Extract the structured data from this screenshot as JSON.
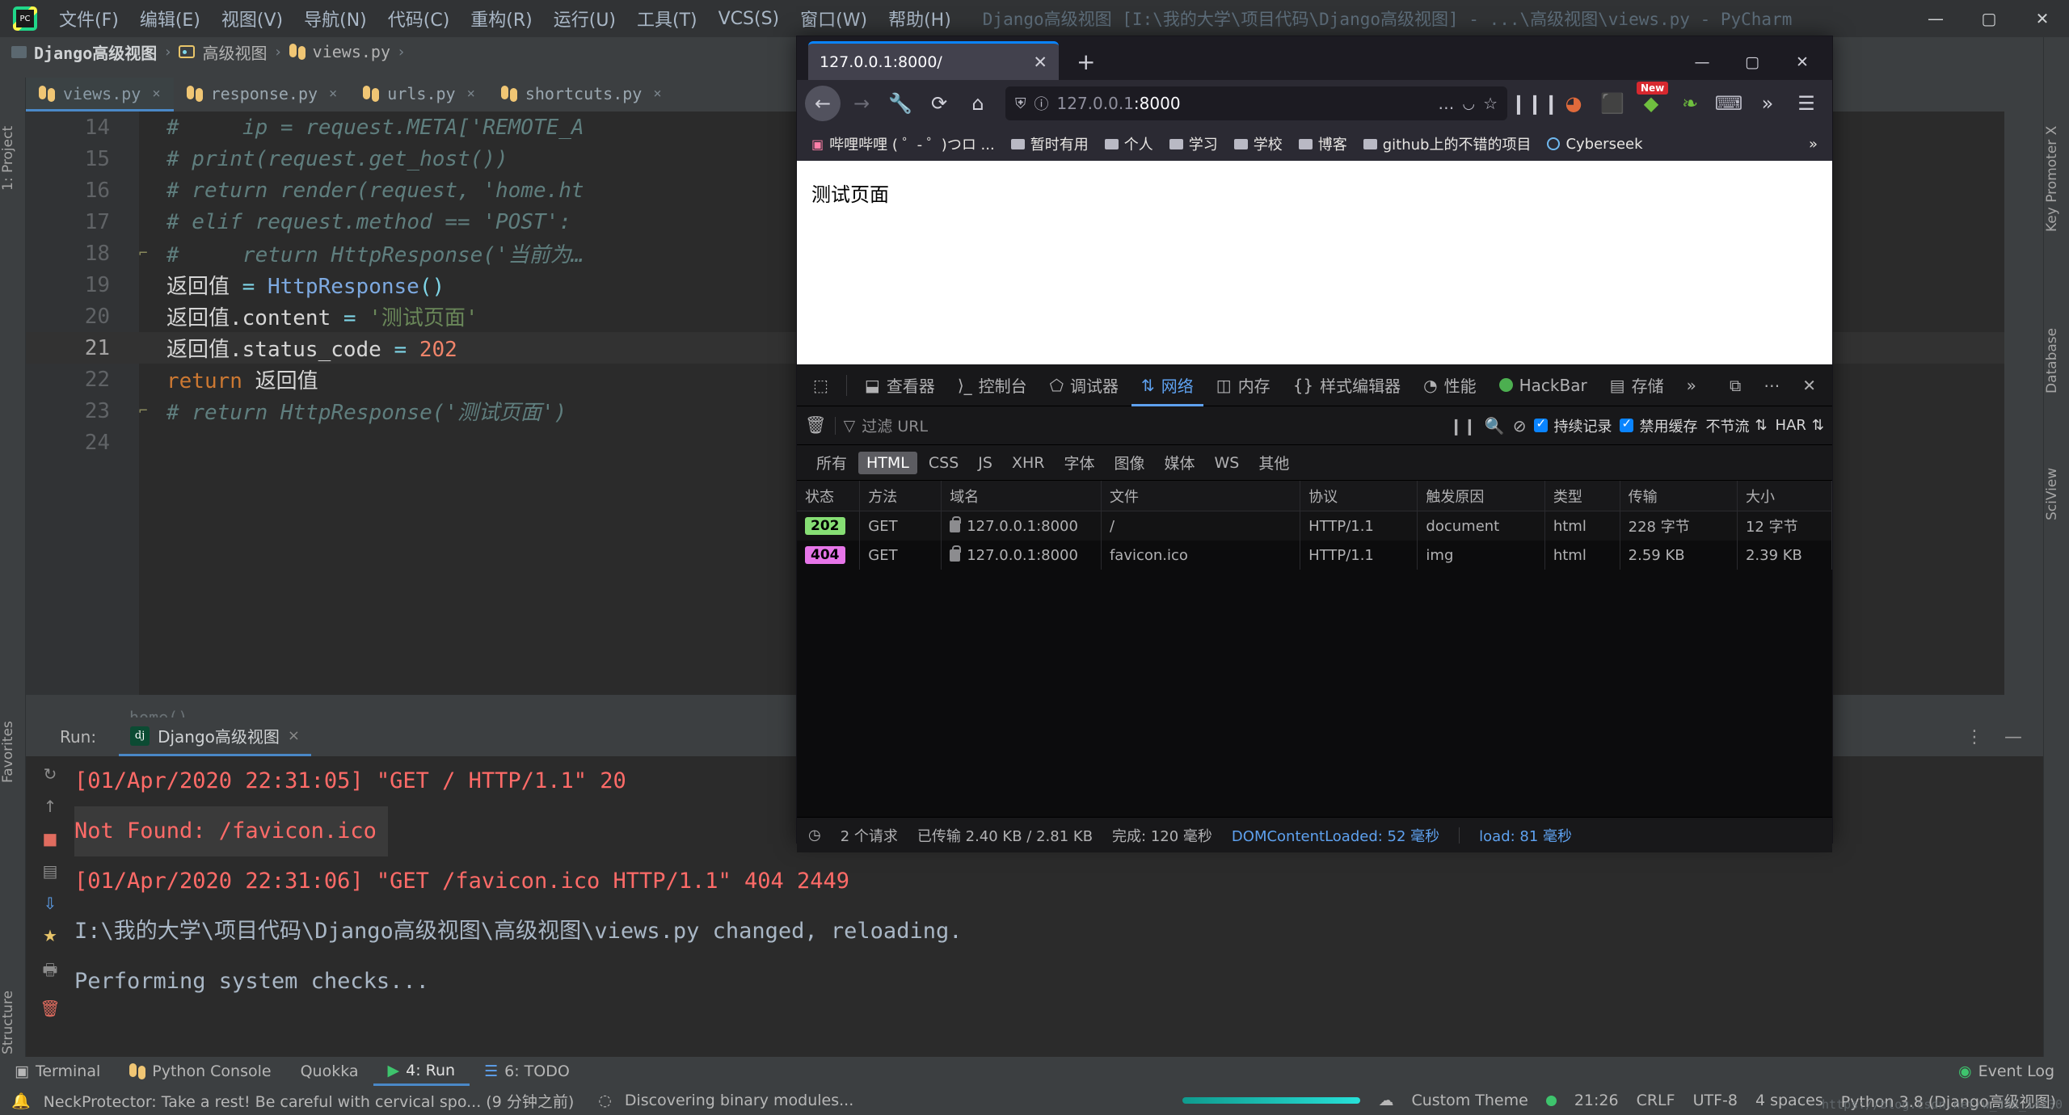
{
  "ide": {
    "menu": [
      {
        "label": "文件(F)"
      },
      {
        "label": "编辑(E)"
      },
      {
        "label": "视图(V)"
      },
      {
        "label": "导航(N)"
      },
      {
        "label": "代码(C)"
      },
      {
        "label": "重构(R)"
      },
      {
        "label": "运行(U)"
      },
      {
        "label": "工具(T)"
      },
      {
        "label": "VCS(S)"
      },
      {
        "label": "窗口(W)"
      },
      {
        "label": "帮助(H)"
      }
    ],
    "window_title": "Django高级视图 [I:\\我的大学\\项目代码\\Django高级视图] - ...\\高级视图\\views.py - PyCharm",
    "window_controls": {
      "minimize": "—",
      "maximize": "▢",
      "close": "✕"
    },
    "breadcrumb": [
      {
        "label": "Django高级视图",
        "icon": "folder-icon"
      },
      {
        "label": "高级视图",
        "icon": "folder-open-icon"
      },
      {
        "label": "views.py",
        "icon": "python-file-icon"
      }
    ],
    "breadcrumb_sep": "›",
    "tabs": [
      {
        "label": "views.py",
        "active": true
      },
      {
        "label": "response.py",
        "active": false
      },
      {
        "label": "urls.py",
        "active": false
      },
      {
        "label": "shortcuts.py",
        "active": false
      }
    ],
    "tab_close": "×",
    "code": [
      {
        "num": "14",
        "segments": [
          {
            "t": "comment",
            "v": "#     ip = request.META['REMOTE_A"
          }
        ]
      },
      {
        "num": "15",
        "segments": [
          {
            "t": "comment",
            "v": "# print(request.get_host())"
          }
        ]
      },
      {
        "num": "16",
        "segments": [
          {
            "t": "comment",
            "v": "# return render(request, 'home.ht"
          }
        ]
      },
      {
        "num": "17",
        "segments": [
          {
            "t": "comment",
            "v": "# elif request.method == 'POST':"
          }
        ]
      },
      {
        "num": "18",
        "segments": [
          {
            "t": "comment",
            "v": "#     return HttpResponse('当前为…"
          }
        ],
        "fold": true
      },
      {
        "num": "19",
        "segments": [
          {
            "t": "var",
            "v": "返回值 "
          },
          {
            "t": "op",
            "v": "= "
          },
          {
            "t": "fn",
            "v": "HttpResponse"
          },
          {
            "t": "op",
            "v": "()"
          }
        ]
      },
      {
        "num": "20",
        "segments": [
          {
            "t": "var",
            "v": "返回值.content "
          },
          {
            "t": "op",
            "v": "= "
          },
          {
            "t": "str",
            "v": "'测试页面'"
          }
        ]
      },
      {
        "num": "21",
        "segments": [
          {
            "t": "var",
            "v": "返回值.status_code "
          },
          {
            "t": "op",
            "v": "= "
          },
          {
            "t": "num",
            "v": "202"
          }
        ],
        "current": true
      },
      {
        "num": "22",
        "segments": [
          {
            "t": "kw",
            "v": "return "
          },
          {
            "t": "var",
            "v": "返回值"
          }
        ]
      },
      {
        "num": "23",
        "segments": [
          {
            "t": "comment",
            "v": "# return HttpResponse('测试页面')"
          }
        ],
        "fold": true
      },
      {
        "num": "24",
        "segments": []
      }
    ],
    "structure_hint": "home()",
    "left_strip": [
      "1: Project",
      "Favorites",
      "7: Structure"
    ],
    "right_strip": [
      "Key Promoter X",
      "Database",
      "SciView"
    ],
    "run_panel": {
      "label": "Run:",
      "tab": "Django高级视图",
      "tab_close": "×",
      "console": [
        {
          "text": "[01/Apr/2020 22:31:05] \"GET / HTTP/1.1\" 20",
          "error": true
        },
        {
          "text": "Not Found: /favicon.ico",
          "error": true,
          "highlight": true
        },
        {
          "text": "[01/Apr/2020 22:31:06] \"GET /favicon.ico HTTP/1.1\" 404 2449",
          "error": true
        },
        {
          "text": "I:\\我的大学\\项目代码\\Django高级视图\\高级视图\\views.py changed, reloading.",
          "error": false
        },
        {
          "text": "Performing system checks...",
          "error": false
        }
      ]
    },
    "bottom_tools": [
      {
        "label": "Terminal",
        "icon": "terminal-icon",
        "active": false
      },
      {
        "label": "Python Console",
        "icon": "python-icon",
        "active": false
      },
      {
        "label": "Quokka",
        "icon": "quokka-icon",
        "active": false
      },
      {
        "label": "4: Run",
        "icon": "run-icon",
        "active": true
      },
      {
        "label": "6: TODO",
        "icon": "todo-icon",
        "active": false
      },
      {
        "label": "Event Log",
        "icon": "event-log-icon",
        "active": false
      }
    ],
    "status_bar": {
      "left_message": "NeckProtector: Take a rest! Be careful with cervical spo... (9 分钟之前)",
      "progress_message": "Discovering binary modules...",
      "theme": "Custom Theme",
      "clock": "21:26",
      "line_sep": "CRLF",
      "encoding": "UTF-8",
      "indent": "4 spaces",
      "interpreter": "Python 3.8 (Django高级视图)",
      "watermark": "https://blog.csdn.net/w_396_14230"
    }
  },
  "firefox": {
    "tab": {
      "title": "127.0.0.1:8000/",
      "close": "✕"
    },
    "new_tab": "+",
    "window_controls": {
      "minimize": "—",
      "maximize": "▢",
      "close": "✕"
    },
    "nav": {
      "back": "←",
      "forward": "→",
      "tools": "wrench-icon",
      "reload": "⟳",
      "home": "⌂"
    },
    "url": {
      "protocol_dim": "127.0.0.1",
      "value": "127.0.0.1:8000",
      "port": ":8000",
      "shield": "shield-icon",
      "info": "info-icon",
      "more": "…",
      "pocket": "pocket-icon",
      "star": "star-icon"
    },
    "toolbar_icons": [
      "library-icon",
      "container-icon",
      "addon-icon",
      "new-badge-addon",
      "leaf-icon",
      "dev-icon",
      "chevrons-icon",
      "menu-icon"
    ],
    "new_badge": "New",
    "bookmarks": [
      {
        "label": "哔哩哔哩 ( ゜- ゜)つロ ...",
        "icon": "site-icon"
      },
      {
        "label": "暂时有用",
        "icon": "folder-icon"
      },
      {
        "label": "个人",
        "icon": "folder-icon"
      },
      {
        "label": "学习",
        "icon": "folder-icon"
      },
      {
        "label": "学校",
        "icon": "folder-icon"
      },
      {
        "label": "博客",
        "icon": "folder-icon"
      },
      {
        "label": "github上的不错的项目",
        "icon": "folder-icon"
      },
      {
        "label": "Cyberseek",
        "icon": "globe-icon"
      }
    ],
    "bookmarks_overflow": "»",
    "page_text": "测试页面"
  },
  "devtools": {
    "tabs": [
      {
        "label": "查看器",
        "icon": "inspector-icon",
        "active": false
      },
      {
        "label": "控制台",
        "icon": "console-icon",
        "active": false
      },
      {
        "label": "调试器",
        "icon": "debugger-icon",
        "active": false
      },
      {
        "label": "网络",
        "icon": "network-icon",
        "active": true
      },
      {
        "label": "内存",
        "icon": "memory-icon",
        "active": false
      },
      {
        "label": "样式编辑器",
        "icon": "style-editor-icon",
        "active": false
      },
      {
        "label": "性能",
        "icon": "performance-icon",
        "active": false
      },
      {
        "label": "HackBar",
        "icon": "hackbar-icon",
        "active": false
      },
      {
        "label": "存储",
        "icon": "storage-icon",
        "active": false
      }
    ],
    "tabs_overflow": "»",
    "picker_icon": "element-picker-icon",
    "right_icons": [
      "responsive-design-icon",
      "meatball-menu-icon",
      "close-icon"
    ],
    "filter": {
      "trash_icon": "trash-icon",
      "placeholder": "过滤 URL",
      "pause_icon": "pause-icon",
      "search_icon": "search-icon",
      "block_icon": "block-icon",
      "persist_logs": "持续记录",
      "disable_cache": "禁用缓存",
      "throttling": "不节流",
      "har": "HAR"
    },
    "types": [
      "所有",
      "HTML",
      "CSS",
      "JS",
      "XHR",
      "字体",
      "图像",
      "媒体",
      "WS",
      "其他"
    ],
    "active_type": "HTML",
    "columns": [
      "状态",
      "方法",
      "域名",
      "文件",
      "协议",
      "触发原因",
      "类型",
      "传输",
      "大小"
    ],
    "rows": [
      {
        "status": "202",
        "method": "GET",
        "domain": "127.0.0.1:8000",
        "file": "/",
        "protocol": "HTTP/1.1",
        "cause": "document",
        "type": "html",
        "transfer": "228 字节",
        "size": "12 字节"
      },
      {
        "status": "404",
        "method": "GET",
        "domain": "127.0.0.1:8000",
        "file": "favicon.ico",
        "protocol": "HTTP/1.1",
        "cause": "img",
        "type": "html",
        "transfer": "2.59 KB",
        "size": "2.39 KB"
      }
    ],
    "status": {
      "clock_icon": "clock-icon",
      "requests": "2 个请求",
      "transferred": "已传输 2.40 KB / 2.81 KB",
      "finish": "完成: 120 毫秒",
      "domcontentloaded": "DOMContentLoaded: 52 毫秒",
      "load": "load: 81 毫秒"
    }
  }
}
